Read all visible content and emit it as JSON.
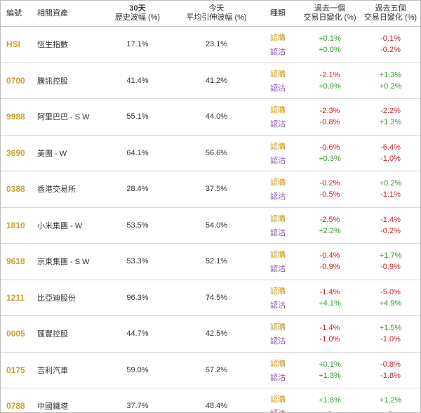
{
  "headers": {
    "code": "編號",
    "asset": "相關資產",
    "vol_top": "30天",
    "vol_bottom": "歷史波幅 (%)",
    "iv_top": "今天",
    "iv_bottom": "平均引伸波幅 (%)",
    "type": "種類",
    "chg1_top": "過去一個",
    "chg1_bottom": "交易日變化 (%)",
    "chg5_top": "過去五個",
    "chg5_bottom": "交易日變化 (%)"
  },
  "type_labels": {
    "call": "認購",
    "put": "認沽"
  },
  "colors": {
    "code": "#c8a232",
    "call": "#d39a1a",
    "put": "#8a4fb8",
    "positive": "#2e9a2e",
    "negative": "#d11d1d"
  },
  "rows": [
    {
      "code": "HSI",
      "name": "恆生指數",
      "hist_vol": "17.1%",
      "implied_vol": "23.1%",
      "call_1d": "+0.1%",
      "put_1d": "+0.0%",
      "call_5d": "-0.1%",
      "put_5d": "-0.2%"
    },
    {
      "code": "0700",
      "name": "騰訊控股",
      "hist_vol": "41.4%",
      "implied_vol": "41.2%",
      "call_1d": "-2.1%",
      "put_1d": "+0.9%",
      "call_5d": "+1.3%",
      "put_5d": "+0.2%"
    },
    {
      "code": "9988",
      "name": "阿里巴巴 - S W",
      "hist_vol": "55.1%",
      "implied_vol": "44.0%",
      "call_1d": "-2.3%",
      "put_1d": "-0.8%",
      "call_5d": "-2.2%",
      "put_5d": "+1.3%"
    },
    {
      "code": "3690",
      "name": "美團 - W",
      "hist_vol": "64.1%",
      "implied_vol": "56.6%",
      "call_1d": "-0.6%",
      "put_1d": "+0.3%",
      "call_5d": "-6.4%",
      "put_5d": "-1.0%"
    },
    {
      "code": "0388",
      "name": "香港交易所",
      "hist_vol": "28.4%",
      "implied_vol": "37.5%",
      "call_1d": "-0.2%",
      "put_1d": "-0.5%",
      "call_5d": "+0.2%",
      "put_5d": "-1.1%"
    },
    {
      "code": "1810",
      "name": "小米集團 - W",
      "hist_vol": "53.5%",
      "implied_vol": "54.0%",
      "call_1d": "-2.5%",
      "put_1d": "+2.2%",
      "call_5d": "-1.4%",
      "put_5d": "-0.2%"
    },
    {
      "code": "9618",
      "name": "京東集團 - S W",
      "hist_vol": "53.3%",
      "implied_vol": "52.1%",
      "call_1d": "-0.4%",
      "put_1d": "-0.9%",
      "call_5d": "+1.7%",
      "put_5d": "-0.9%"
    },
    {
      "code": "1211",
      "name": "比亞迪股份",
      "hist_vol": "96.3%",
      "implied_vol": "74.5%",
      "call_1d": "-1.4%",
      "put_1d": "+4.1%",
      "call_5d": "-5.0%",
      "put_5d": "+4.9%"
    },
    {
      "code": "0005",
      "name": "匯豐控股",
      "hist_vol": "44.7%",
      "implied_vol": "42.5%",
      "call_1d": "-1.4%",
      "put_1d": "-1.0%",
      "call_5d": "+1.5%",
      "put_5d": "-1.0%"
    },
    {
      "code": "0175",
      "name": "吉利汽車",
      "hist_vol": "59.0%",
      "implied_vol": "57.2%",
      "call_1d": "+0.1%",
      "put_1d": "+1.3%",
      "call_5d": "-0.8%",
      "put_5d": "-1.8%"
    },
    {
      "code": "0788",
      "name": "中國鐵塔",
      "hist_vol": "37.7%",
      "implied_vol": "48.4%",
      "call_1d": "+1.8%",
      "put_1d": "-",
      "call_5d": "+1.2%",
      "put_5d": "-"
    }
  ]
}
